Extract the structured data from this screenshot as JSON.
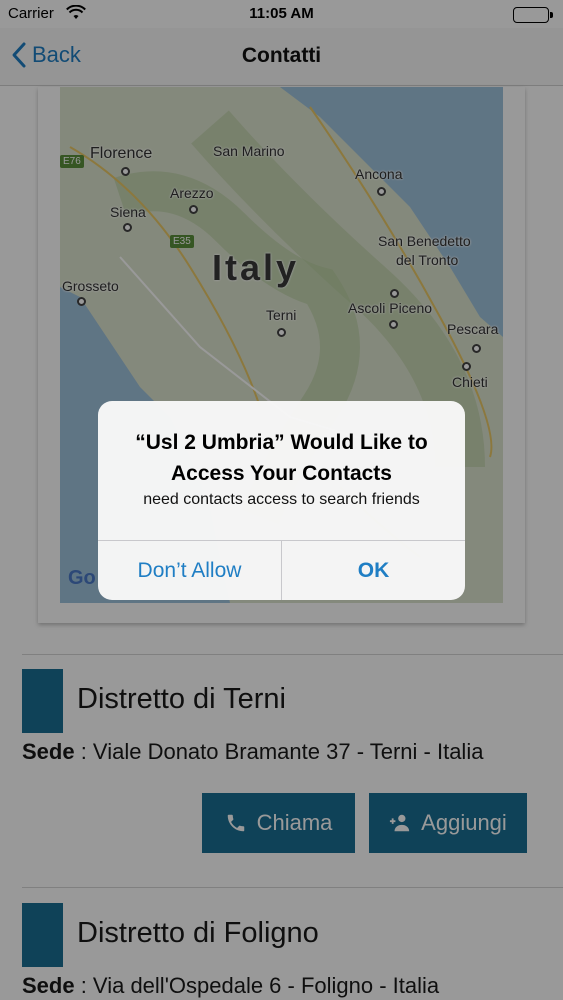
{
  "status_bar": {
    "carrier": "Carrier",
    "time": "11:05 AM"
  },
  "nav": {
    "back_label": "Back",
    "title": "Contatti"
  },
  "map": {
    "labels": {
      "florence": "Florence",
      "san_marino": "San Marino",
      "ancona": "Ancona",
      "arezzo": "Arezzo",
      "siena": "Siena",
      "san_benedetto_1": "San Benedetto",
      "san_benedetto_2": "del Tronto",
      "italy": "Italy",
      "grosseto": "Grosseto",
      "ascoli": "Ascoli Piceno",
      "terni": "Terni",
      "pescara": "Pescara",
      "chieti": "Chieti",
      "e76": "E76",
      "e35": "E35",
      "google": "Go"
    }
  },
  "districts": [
    {
      "name": "Distretto di Terni",
      "address_label": "Sede",
      "address": " : Viale Donato Bramante 37 - Terni - Italia",
      "call_label": "Chiama",
      "add_label": "Aggiungi"
    },
    {
      "name": "Distretto di Foligno",
      "address_label": "Sede",
      "address": " : Via dell'Ospedale 6 - Foligno - Italia"
    }
  ],
  "alert": {
    "title": "“Usl 2 Umbria” Would Like to Access Your Contacts",
    "message": "need contacts access to search friends",
    "deny_label": "Don’t Allow",
    "ok_label": "OK"
  },
  "colors": {
    "accent": "#1a6e93",
    "link": "#1f7ec4"
  }
}
